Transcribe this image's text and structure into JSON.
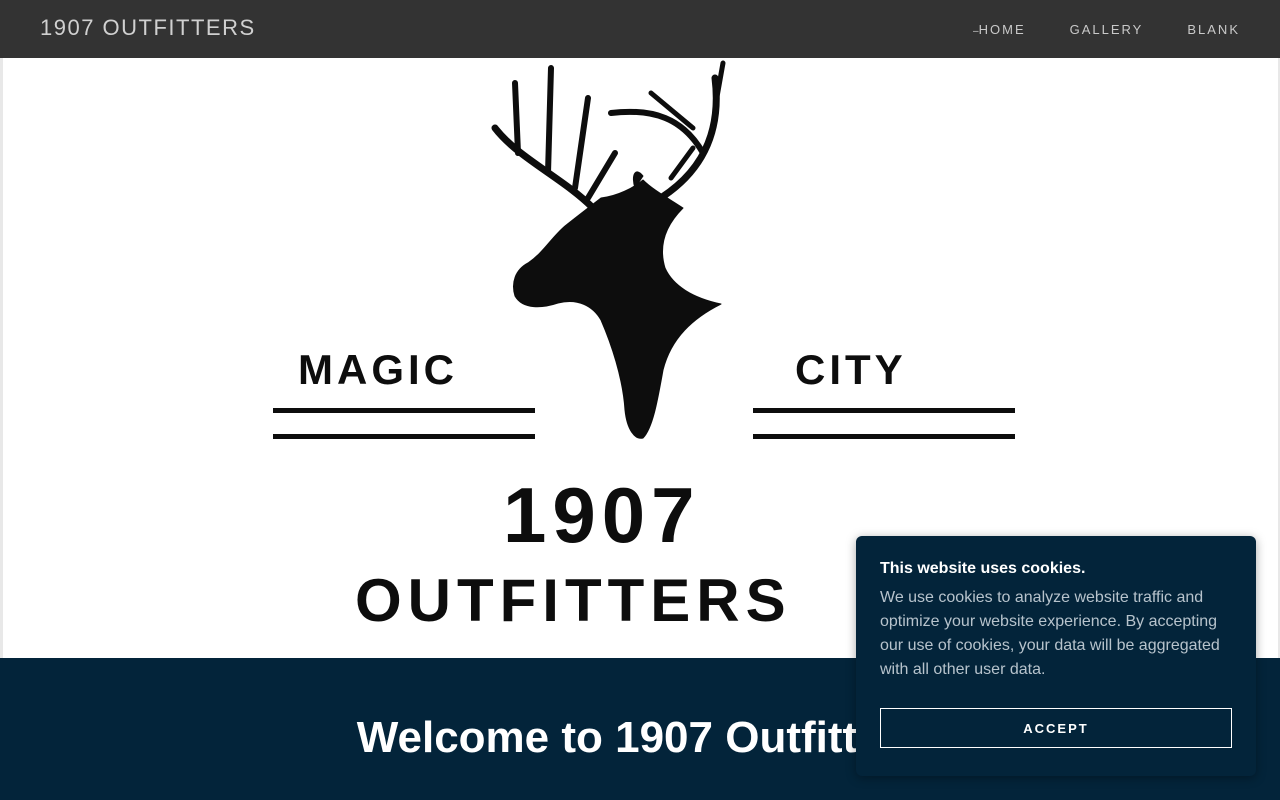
{
  "header": {
    "site_title": "1907 OUTFITTERS",
    "nav": [
      {
        "label": "HOME",
        "active": true
      },
      {
        "label": "GALLERY",
        "active": false
      },
      {
        "label": "BLANK",
        "active": false
      }
    ]
  },
  "hero_logo": {
    "word_left": "MAGIC",
    "word_right": "CITY",
    "year": "1907",
    "name": "OUTFITTERS",
    "icon": "deer-head-icon"
  },
  "welcome": {
    "heading": "Welcome to 1907 Outfitters"
  },
  "cookie_banner": {
    "title": "This website uses cookies.",
    "text": "We use cookies to analyze website traffic and optimize your website experience. By accepting our use of cookies, your data will be aggregated with all other user data.",
    "accept_label": "ACCEPT"
  },
  "colors": {
    "header_bg": "#333333",
    "band_bg": "#03243a",
    "logo_ink": "#0d0d0d"
  }
}
